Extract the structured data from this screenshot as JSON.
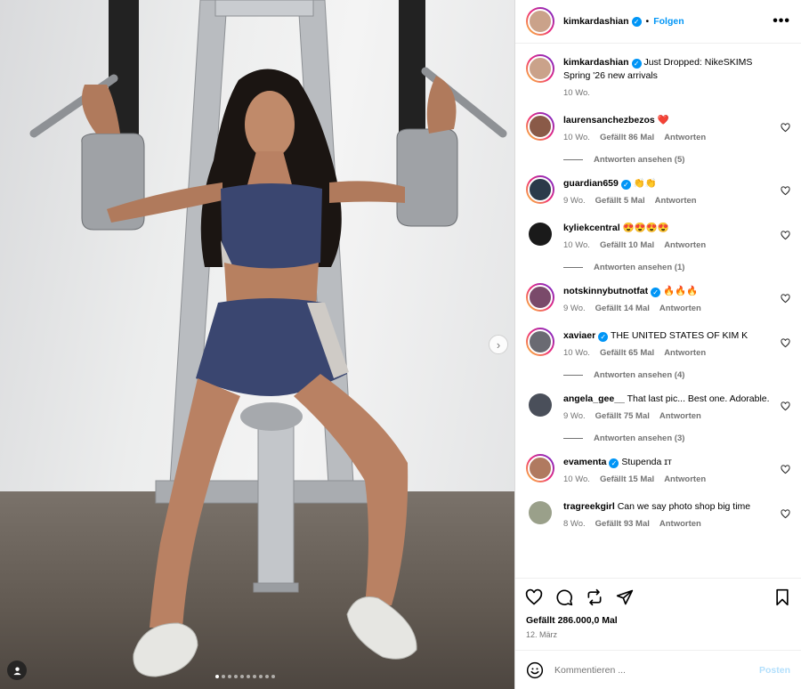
{
  "post": {
    "author": "kimkardashian",
    "follow_label": "Folgen",
    "more_label": "•••",
    "next_arrow": "›",
    "carousel_count": 10,
    "carousel_active": 0
  },
  "caption": {
    "username": "kimkardashian",
    "text": "Just Dropped: NikeSKIMS Spring '26 new arrivals",
    "time": "10 Wo."
  },
  "comments": [
    {
      "username": "laurensanchezbezos",
      "verified": false,
      "text": "❤️",
      "time": "10 Wo.",
      "likes": "Gefällt 86 Mal",
      "reply": "Antworten",
      "view_replies": "Antworten ansehen (5)",
      "avatar_color": "#8a5a48",
      "ring": true
    },
    {
      "username": "guardian659",
      "verified": true,
      "text": "👏👏",
      "time": "9 Wo.",
      "likes": "Gefällt 5 Mal",
      "reply": "Antworten",
      "view_replies": "",
      "avatar_color": "#2b3a4a",
      "ring": true
    },
    {
      "username": "kyliekcentral",
      "verified": false,
      "text": "😍😍😍😍",
      "time": "10 Wo.",
      "likes": "Gefällt 10 Mal",
      "reply": "Antworten",
      "view_replies": "Antworten ansehen (1)",
      "avatar_color": "#1a1a1a",
      "ring": false
    },
    {
      "username": "notskinnybutnotfat",
      "verified": true,
      "text": "🔥🔥🔥",
      "time": "9 Wo.",
      "likes": "Gefällt 14 Mal",
      "reply": "Antworten",
      "view_replies": "",
      "avatar_color": "#7a4a6a",
      "ring": true
    },
    {
      "username": "xaviaer",
      "verified": true,
      "text": "THE UNITED STATES OF KIM K",
      "time": "10 Wo.",
      "likes": "Gefällt 65 Mal",
      "reply": "Antworten",
      "view_replies": "Antworten ansehen (4)",
      "avatar_color": "#6a6a72",
      "ring": true
    },
    {
      "username": "angela_gee__",
      "verified": false,
      "text": "That last pic... Best one. Adorable.",
      "time": "9 Wo.",
      "likes": "Gefällt 75 Mal",
      "reply": "Antworten",
      "view_replies": "Antworten ansehen (3)",
      "avatar_color": "#4a4f5a",
      "ring": false
    },
    {
      "username": "evamenta",
      "verified": true,
      "text": "Stupenda ɪᴛ",
      "time": "10 Wo.",
      "likes": "Gefällt 15 Mal",
      "reply": "Antworten",
      "view_replies": "",
      "avatar_color": "#b07a60",
      "ring": true
    },
    {
      "username": "tragreekgirl",
      "verified": false,
      "text": "Can we say photo shop big time",
      "time": "8 Wo.",
      "likes": "Gefällt 93 Mal",
      "reply": "Antworten",
      "view_replies": "",
      "avatar_color": "#9aa08a",
      "ring": false
    }
  ],
  "engagement": {
    "likes": "Gefällt 286.000,0 Mal",
    "date": "12. März"
  },
  "composer": {
    "placeholder": "Kommentieren ...",
    "post_label": "Posten"
  },
  "colors": {
    "accent": "#0095f6",
    "muted": "#737373",
    "post_disabled": "#b2dffc"
  },
  "icons": [
    "heart-icon",
    "comment-icon",
    "share-icon",
    "send-icon",
    "bookmark-icon",
    "emoji-icon",
    "more-icon",
    "verified-icon",
    "user-tag-icon",
    "chevron-right-icon"
  ]
}
